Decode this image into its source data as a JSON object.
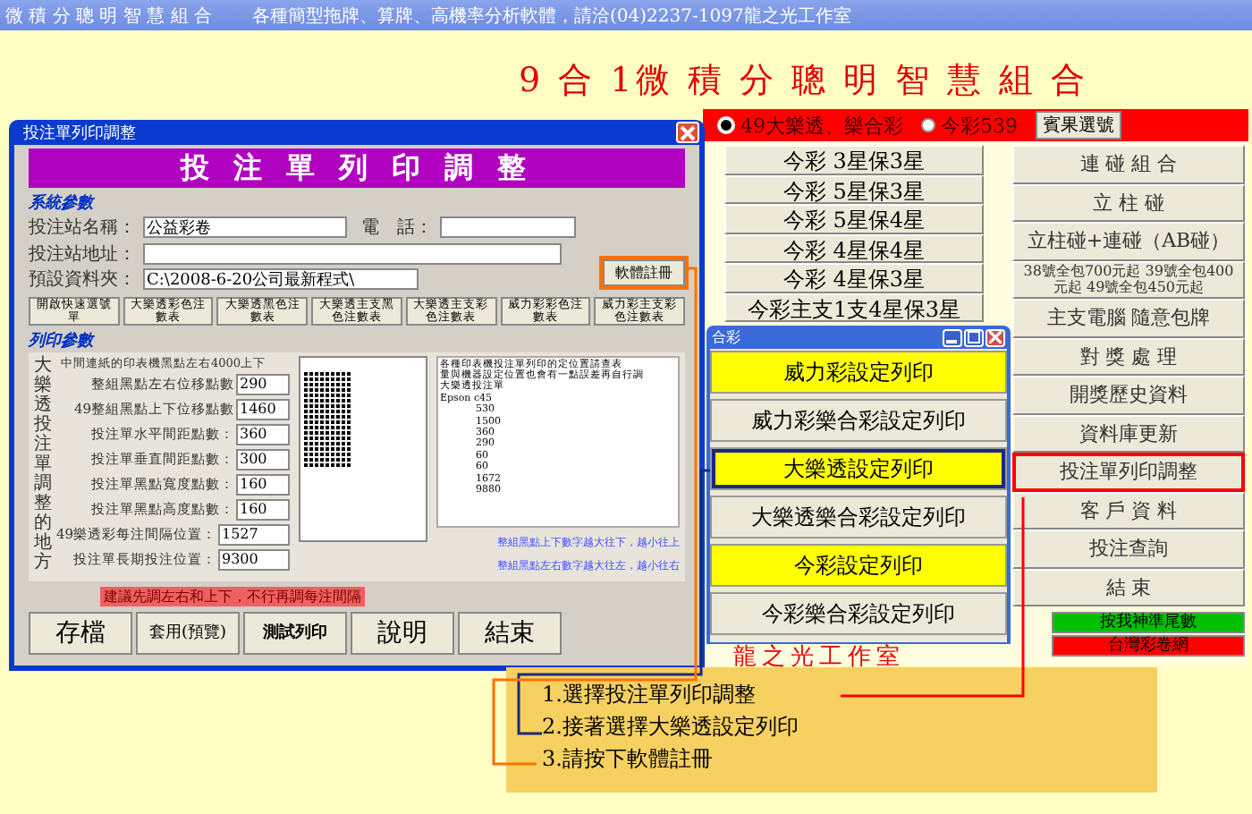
{
  "top_bar": {
    "left": "微 積 分 聰 明 智 慧 組 合",
    "center": "各種簡型拖牌、算牌、高機率分析軟體，請洽(04)2237-1097龍之光工作室"
  },
  "app_title": "9 合 1微 積 分 聰 明 智 慧 組 合",
  "main_panel": {
    "radios": [
      {
        "label": "49大樂透、樂合彩",
        "selected": true
      },
      {
        "label": "今彩539",
        "selected": false
      }
    ],
    "bingo_button": "賓果選號",
    "left_buttons": [
      "今彩 3星保3星",
      "今彩 5星保3星",
      "今彩 5星保4星",
      "今彩 4星保4星",
      "今彩 4星保3星",
      "今彩主支1支4星保3星"
    ],
    "right_buttons": [
      {
        "label": "連 碰 組 合",
        "kind": "normal",
        "selected": false
      },
      {
        "label": "立 柱 碰",
        "kind": "normal",
        "selected": false
      },
      {
        "label": "立柱碰+連碰（AB碰）",
        "kind": "normal",
        "selected": false
      },
      {
        "label": "38號全包700元起 39號全包400元起 49號全包450元起",
        "kind": "small",
        "selected": false
      },
      {
        "label": "主支電腦 隨意包牌",
        "kind": "normal",
        "selected": false
      },
      {
        "label": "對 獎 處 理",
        "kind": "normal",
        "selected": false
      },
      {
        "label": "開獎歷史資料",
        "kind": "normal",
        "selected": false
      },
      {
        "label": "資料庫更新",
        "kind": "normal",
        "selected": false
      },
      {
        "label": "投注單列印調整",
        "kind": "normal",
        "selected": true
      },
      {
        "label": "客 戶 資 料",
        "kind": "normal",
        "selected": false
      },
      {
        "label": "投注查詢",
        "kind": "normal",
        "selected": false
      },
      {
        "label": "結 束",
        "kind": "normal",
        "selected": false
      }
    ],
    "links": [
      {
        "label": "按我神準尾數",
        "color": "#00c000"
      },
      {
        "label": "台灣彩卷網",
        "color": "#ff0000"
      }
    ]
  },
  "studio_text": "龍之光工作室",
  "dialog": {
    "title": "投注單列印調整",
    "header": "投 注 單 列 印 調 整",
    "system_legend": "系統參數",
    "station_name": {
      "label": "投注站名稱：",
      "value": "公益彩卷"
    },
    "phone": {
      "label": "電　話："
    },
    "address": {
      "label": "投注站地址："
    },
    "folder": {
      "label": "預設資料夾：",
      "value": "C:\\2008-6-20公司最新程式\\"
    },
    "register_button": {
      "label": "軟體註冊",
      "highlighted": true
    },
    "table_buttons": [
      "開啟快速選號單",
      "大樂透彩色注數表",
      "大樂透黑色注數表",
      "大樂透主支黑色注數表",
      "大樂透主支彩色注數表",
      "威力彩彩色注數表",
      "威力彩主支彩色注數表"
    ],
    "print_legend": "列印參數",
    "vertical_note": "大樂透投注單調整的地方",
    "hint": "中間連紙的印表機黑點左右4000上下",
    "fields": [
      {
        "label": "整組黑點左右位移點數",
        "value": "290"
      },
      {
        "label": "49整組黑點上下位移點數",
        "value": "1460"
      },
      {
        "label": "投注單水平間距點數：",
        "value": "360"
      },
      {
        "label": "投注單垂直間距點數：",
        "value": "300"
      },
      {
        "label": "投注單黑點寬度點數：",
        "value": "160"
      },
      {
        "label": "投注單黑點高度點數：",
        "value": "160"
      },
      {
        "label": "49樂透彩每注間隔位置：",
        "value": "1527"
      },
      {
        "label": "投注單長期投注位置：",
        "value": "9300"
      }
    ],
    "info_lines": [
      "各種印表機投注單列印的定位置請查表",
      "量與機器設定位置也會有一點誤差再自行調",
      "大樂透投注單",
      "Epson c45",
      "530",
      "1500",
      "360",
      "290",
      "60",
      "60",
      "1672",
      "9880"
    ],
    "notes": [
      "整組黑點上下數字越大往下，越小往上",
      "整組黑點左右數字越大往左，越小往右"
    ],
    "warning": "建議先調左右和上下，不行再調每注間隔",
    "bottom_buttons": [
      "存檔",
      "套用(預覽)",
      "測試列印",
      "說明",
      "結束"
    ]
  },
  "popup": {
    "title": "合彩",
    "buttons": [
      {
        "label": "威力彩設定列印",
        "highlight": true,
        "selected": false
      },
      {
        "label": "威力彩樂合彩設定列印",
        "highlight": false,
        "selected": false
      },
      {
        "label": "大樂透設定列印",
        "highlight": true,
        "selected": true
      },
      {
        "label": "大樂透樂合彩設定列印",
        "highlight": false,
        "selected": false
      },
      {
        "label": "今彩設定列印",
        "highlight": true,
        "selected": false
      },
      {
        "label": "今彩樂合彩設定列印",
        "highlight": false,
        "selected": false
      }
    ]
  },
  "callout": {
    "steps": [
      "1.選擇投注單列印調整",
      "2.接著選擇大樂透設定列印",
      "3.請按下軟體註冊"
    ]
  }
}
